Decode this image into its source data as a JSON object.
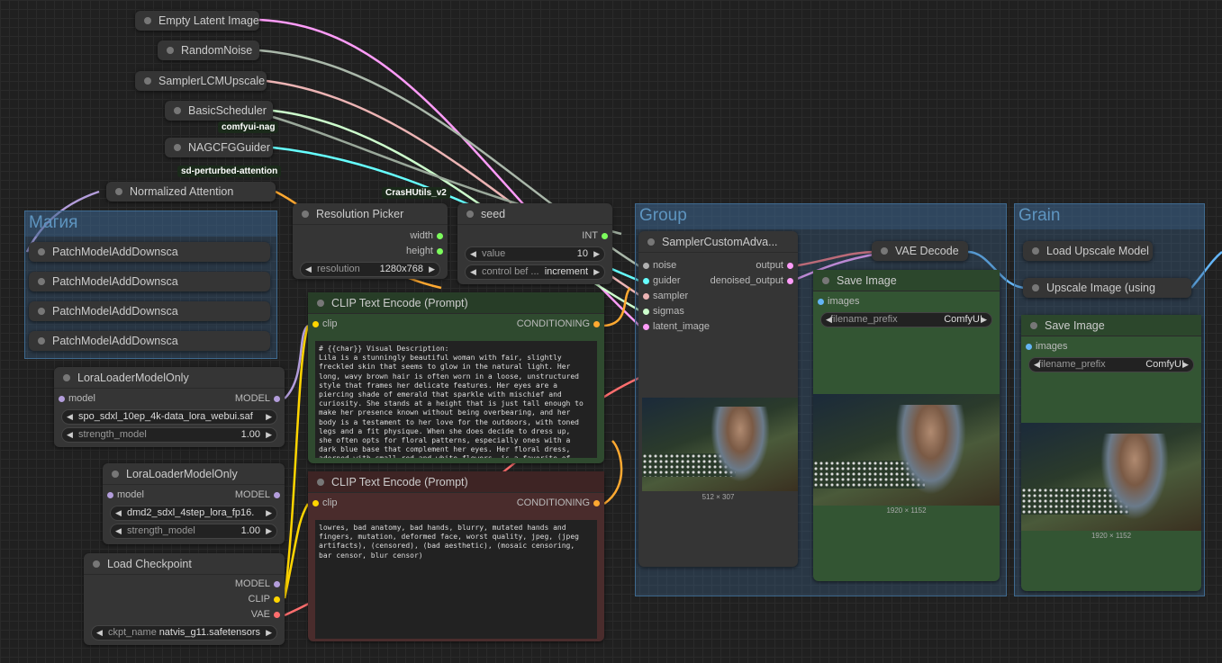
{
  "collapsed_nodes": {
    "empty_latent": "Empty Latent Image",
    "random_noise": "RandomNoise",
    "sampler_lcm": "SamplerLCMUpscale",
    "basic_scheduler": "BasicScheduler",
    "nag_guider": "NAGCFGGuider",
    "normalized_attention": "Normalized Attention",
    "vae_decode": "VAE Decode",
    "load_upscale_model": "Load Upscale Model",
    "upscale_image": "Upscale Image (using"
  },
  "badges": {
    "nag": "comfyui-nag",
    "spa": "sd-perturbed-attention",
    "crash": "CrasHUtils_v2"
  },
  "group_magic": {
    "title": "Магия",
    "items": [
      "PatchModelAddDownsca",
      "PatchModelAddDownsca",
      "PatchModelAddDownsca",
      "PatchModelAddDownsca"
    ]
  },
  "resolution_picker": {
    "title": "Resolution Picker",
    "outputs": [
      "width",
      "height"
    ],
    "widget_label": "resolution",
    "widget_value": "1280x768"
  },
  "seed": {
    "title": "seed",
    "output": "INT",
    "value_label": "value",
    "value": "10",
    "control_label": "control bef ...",
    "control_value": "increment"
  },
  "clip_pos": {
    "title": "CLIP Text Encode (Prompt)",
    "input": "clip",
    "output": "CONDITIONING",
    "text": "# {{char}} Visual Description:\nLila is a stunningly beautiful woman with fair, slightly freckled skin that seems to glow in the natural light. Her long, wavy brown hair is often worn in a loose, unstructured style that frames her delicate features. Her eyes are a piercing shade of emerald that sparkle with mischief and curiosity. She stands at a height that is just tall enough to make her presence known without being overbearing, and her body is a testament to her love for the outdoors, with toned legs and a fit physique. When she does decide to dress up, she often opts for floral patterns, especially ones with a dark blue base that complement her eyes. Her floral dress, adorned with small red and white flowers, is a favorite of hers, as it allows her to feel both elegant and"
  },
  "clip_neg": {
    "title": "CLIP Text Encode (Prompt)",
    "input": "clip",
    "output": "CONDITIONING",
    "text": "lowres, bad anatomy, bad hands, blurry, mutated hands and fingers, mutation, deformed face, worst quality, jpeg, (jpeg artifacts), (censored), (bad aesthetic), (mosaic censoring, bar censor, blur censor)"
  },
  "lora1": {
    "title": "LoraLoaderModelOnly",
    "input": "model",
    "output": "MODEL",
    "lora_name": "spo_sdxl_10ep_4k-data_lora_webui.saf ...",
    "strength_label": "strength_model",
    "strength": "1.00"
  },
  "lora2": {
    "title": "LoraLoaderModelOnly",
    "input": "model",
    "output": "MODEL",
    "lora_name": "dmd2_sdxl_4step_lora_fp16. ...",
    "strength_label": "strength_model",
    "strength": "1.00"
  },
  "checkpoint": {
    "title": "Load Checkpoint",
    "outputs": [
      "MODEL",
      "CLIP",
      "VAE"
    ],
    "ckpt_label": "ckpt_name",
    "ckpt_value": "natvis_g11.safetensors"
  },
  "group_main": {
    "title": "Group"
  },
  "sampler": {
    "title": "SamplerCustomAdva...",
    "inputs": [
      "noise",
      "guider",
      "sampler",
      "sigmas",
      "latent_image"
    ],
    "outputs": [
      "output",
      "denoised_output"
    ],
    "preview_size": "512 × 307"
  },
  "save1": {
    "title": "Save Image",
    "input": "images",
    "prefix_label": "filename_prefix",
    "prefix": "ComfyUI",
    "size": "1920 × 1152"
  },
  "group_grain": {
    "title": "Grain"
  },
  "save2": {
    "title": "Save Image",
    "input": "images",
    "prefix_label": "filename_prefix",
    "prefix": "ComfyUI",
    "size": "1920 × 1152"
  },
  "colors": {
    "model": "#b39ddb",
    "clip": "#ffd500",
    "vae": "#ff6e6e",
    "conditioning": "#ffa931",
    "latent": "#ff9cf9",
    "int": "#7cfc5c",
    "image": "#64b5f6",
    "guider": "#66ffff",
    "sigmas": "#cdffcd",
    "sampler": "#ecb4b4",
    "noise": "#b0b0b0"
  }
}
